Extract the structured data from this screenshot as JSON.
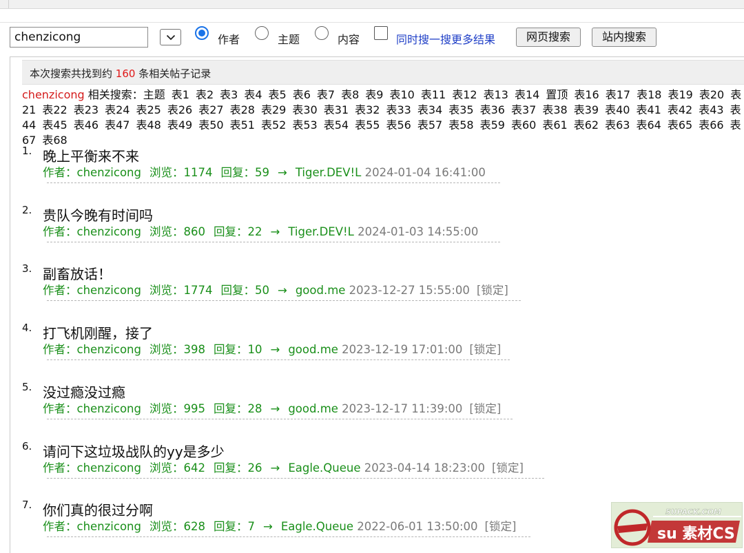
{
  "search": {
    "query": "chenzicong",
    "options": [
      "作者",
      "主题",
      "内容"
    ],
    "selected_option": "作者",
    "also_search_label": "同时搜一搜更多结果",
    "web_search_button": "网页搜索",
    "site_search_button": "站内搜索"
  },
  "summary": {
    "prefix": "本次搜索共找到约 ",
    "count": "160",
    "suffix": " 条相关帖子记录"
  },
  "related": {
    "keyword": "chenzicong",
    "label": " 相关搜索：",
    "tags": [
      "主题",
      "表1",
      "表2",
      "表3",
      "表4",
      "表5",
      "表6",
      "表7",
      "表8",
      "表9",
      "表10",
      "表11",
      "表12",
      "表13",
      "表14",
      "置顶",
      "表16",
      "表17",
      "表18",
      "表19",
      "表20",
      "表21",
      "表22",
      "表23",
      "表24",
      "表25",
      "表26",
      "表27",
      "表28",
      "表29",
      "表30",
      "表31",
      "表32",
      "表33",
      "表34",
      "表35",
      "表36",
      "表37",
      "表38",
      "表39",
      "表40",
      "表41",
      "表42",
      "表43",
      "表44",
      "表45",
      "表46",
      "表47",
      "表48",
      "表49",
      "表50",
      "表51",
      "表52",
      "表53",
      "表54",
      "表55",
      "表56",
      "表57",
      "表58",
      "表59",
      "表60",
      "表61",
      "表62",
      "表63",
      "表64",
      "表65",
      "表66",
      "表67",
      "表68"
    ]
  },
  "meta_labels": {
    "author": "作者：",
    "views": "浏览：",
    "replies": "回复：",
    "arrow": "→"
  },
  "results": [
    {
      "num": "1.",
      "title": "晚上平衡来不来",
      "author": "chenzicong",
      "views": "1174",
      "replies": "59",
      "last_user": "Tiger.DEV!L",
      "time": "2024-01-04 16:41:00",
      "locked": ""
    },
    {
      "num": "2.",
      "title": "贵队今晚有时间吗",
      "author": "chenzicong",
      "views": "860",
      "replies": "22",
      "last_user": "Tiger.DEV!L",
      "time": "2024-01-03 14:55:00",
      "locked": ""
    },
    {
      "num": "3.",
      "title": "副畜放话！",
      "author": "chenzicong",
      "views": "1774",
      "replies": "50",
      "last_user": "good.me",
      "time": "2023-12-27 15:55:00",
      "locked": "[锁定]"
    },
    {
      "num": "4.",
      "title": "打飞机刚醒，接了",
      "author": "chenzicong",
      "views": "398",
      "replies": "10",
      "last_user": "good.me",
      "time": "2023-12-19 17:01:00",
      "locked": "[锁定]"
    },
    {
      "num": "5.",
      "title": "没过瘾没过瘾",
      "author": "chenzicong",
      "views": "995",
      "replies": "28",
      "last_user": "good.me",
      "time": "2023-12-17 11:39:00",
      "locked": "[锁定]"
    },
    {
      "num": "6.",
      "title": "请问下这垃圾战队的yy是多少",
      "author": "chenzicong",
      "views": "642",
      "replies": "26",
      "last_user": "Eagle.Queue",
      "time": "2023-04-14 18:23:00",
      "locked": "[锁定]"
    },
    {
      "num": "7.",
      "title": "你们真的很过分啊",
      "author": "chenzicong",
      "views": "628",
      "replies": "7",
      "last_user": "Eagle.Queue",
      "time": "2022-06-01 13:50:00",
      "locked": "[锁定]"
    }
  ],
  "watermark": {
    "text": "5UPACK.COM",
    "brand": "su 素材CS",
    "colors": {
      "brand_red": "#c0282a",
      "bg": "#e3edd7"
    }
  }
}
